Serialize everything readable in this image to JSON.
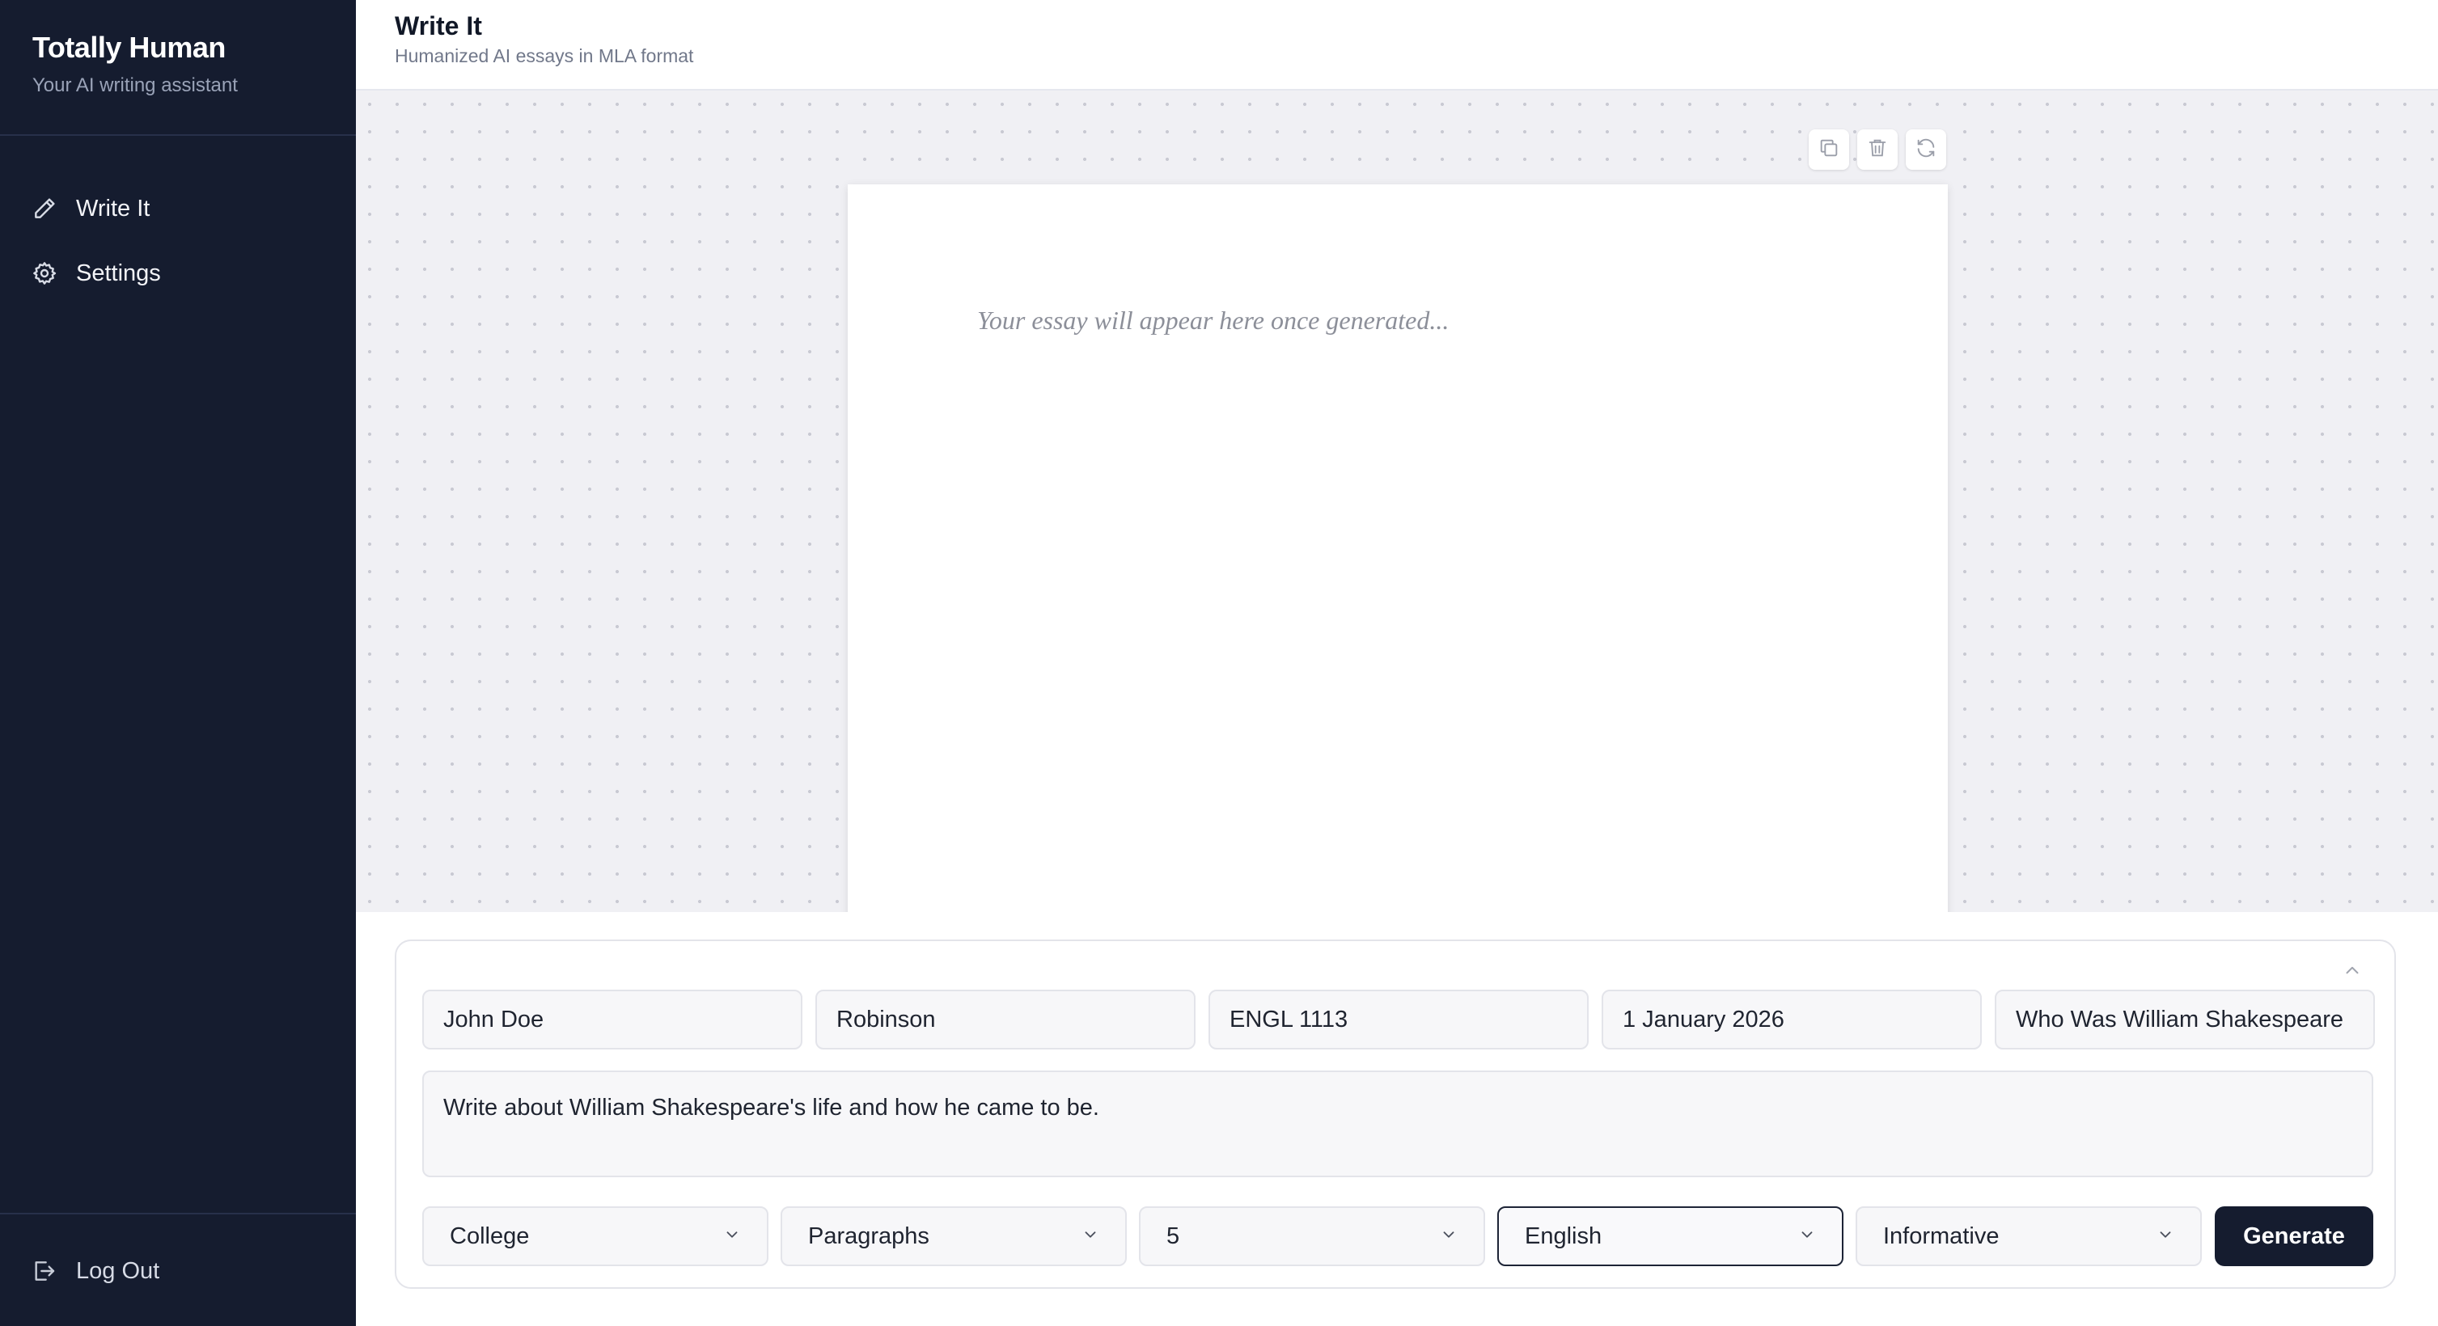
{
  "sidebar": {
    "brand_title": "Totally Human",
    "brand_subtitle": "Your AI writing assistant",
    "items": [
      {
        "label": "Write It",
        "icon": "pencil-icon"
      },
      {
        "label": "Settings",
        "icon": "gear-icon"
      }
    ],
    "logout_label": "Log Out"
  },
  "header": {
    "title": "Write It",
    "subtitle": "Humanized AI essays in MLA format"
  },
  "document": {
    "placeholder": "Your essay will appear here once generated...",
    "tools": [
      "copy-icon",
      "trash-icon",
      "refresh-icon"
    ]
  },
  "form": {
    "student_name": "John Doe",
    "instructor": "Robinson",
    "course": "ENGL 1113",
    "date": "1 January 2026",
    "title": "Who Was William Shakespeare",
    "prompt": "Write about William Shakespeare's life and how he came to be.",
    "level": "College",
    "length_unit": "Paragraphs",
    "length_count": "5",
    "language": "English",
    "essay_type": "Informative",
    "generate_label": "Generate"
  },
  "colors": {
    "sidebar_bg": "#151c2f",
    "accent": "#151c2f",
    "canvas_bg": "#f0f0f4"
  }
}
